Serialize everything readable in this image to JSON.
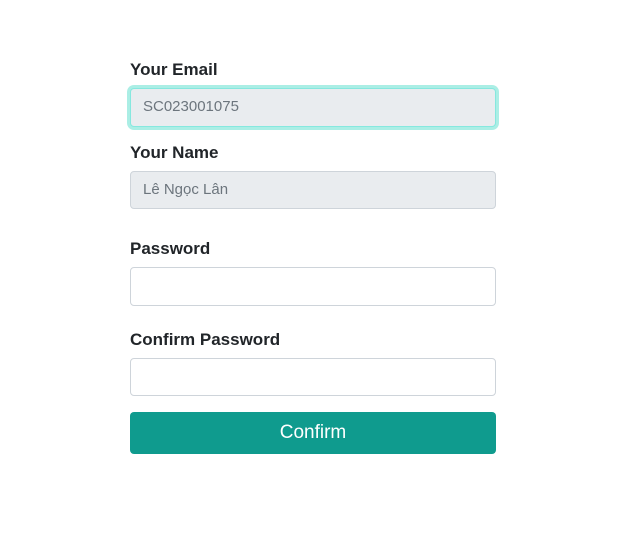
{
  "form": {
    "email": {
      "label": "Your Email",
      "value": "SC023001075"
    },
    "name": {
      "label": "Your Name",
      "value": "Lê Ngọc Lân"
    },
    "password": {
      "label": "Password",
      "value": ""
    },
    "confirm_password": {
      "label": "Confirm Password",
      "value": ""
    },
    "submit_label": "Confirm"
  }
}
